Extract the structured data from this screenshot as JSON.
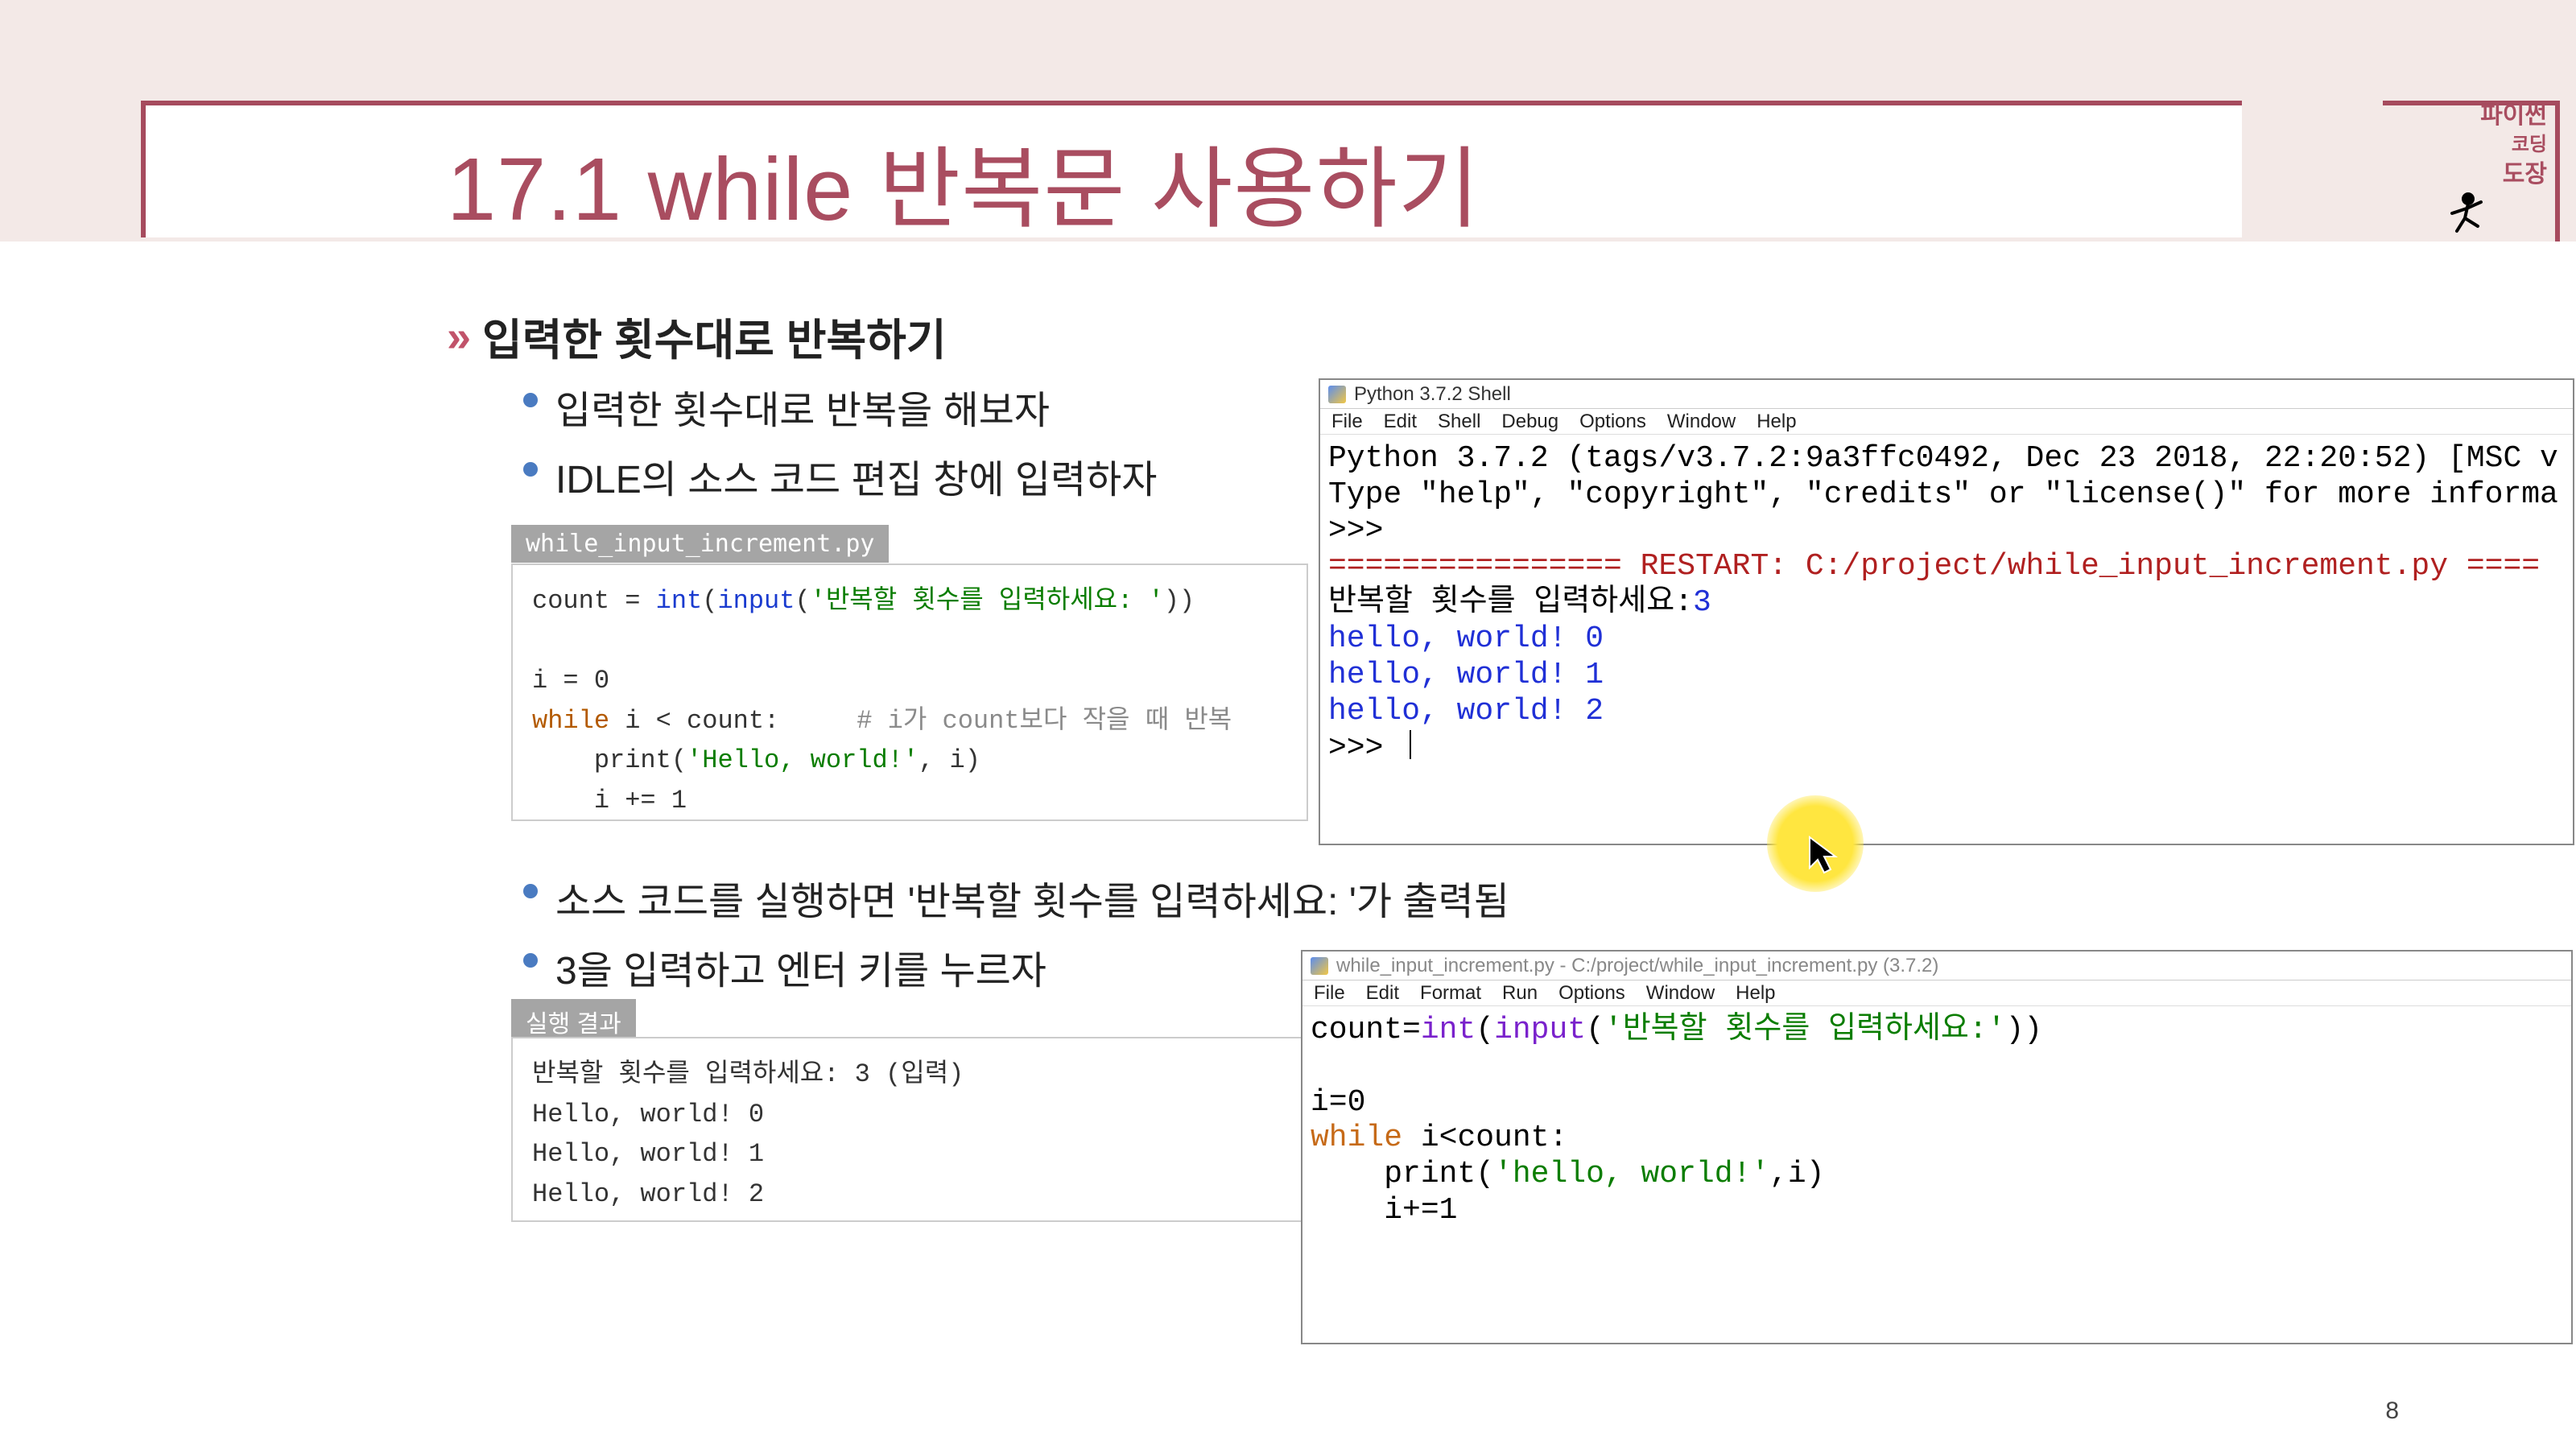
{
  "slide": {
    "title": "17.1 while 반복문 사용하기",
    "subheading": "입력한 횟수대로 반복하기",
    "bullets": [
      "입력한 횟수대로 반복을 해보자",
      "IDLE의 소스 코드 편집 창에 입력하자",
      "소스 코드를 실행하면 '반복할 횟수를 입력하세요: '가 출력됨",
      "3을 입력하고 엔터 키를 누르자"
    ],
    "logo_line1": "파이썬",
    "logo_line2": "코딩",
    "logo_line3": "도장",
    "page_number": "8"
  },
  "code_block": {
    "filename": "while_input_increment.py",
    "line1_a": "count = ",
    "line1_b": "int",
    "line1_c": "(",
    "line1_d": "input",
    "line1_e": "(",
    "line1_f": "'반복할 횟수를 입력하세요: '",
    "line1_g": "))",
    "line3": "i = 0",
    "line4_a": "while",
    "line4_b": " i < count:     ",
    "line4_c": "# i가 count보다 작을 때 반복",
    "line5_a": "    print(",
    "line5_b": "'Hello, world!'",
    "line5_c": ", i)",
    "line6": "    i += 1"
  },
  "result_block": {
    "label": "실행 결과",
    "line1": "반복할 횟수를 입력하세요: 3 (입력)",
    "line2": "Hello, world! 0",
    "line3": "Hello, world! 1",
    "line4": "Hello, world! 2"
  },
  "shell": {
    "title": "Python 3.7.2 Shell",
    "menus": [
      "File",
      "Edit",
      "Shell",
      "Debug",
      "Options",
      "Window",
      "Help"
    ],
    "banner1": "Python 3.7.2 (tags/v3.7.2:9a3ffc0492, Dec 23 2018, 22:20:52) [MSC v",
    "banner2": "Type \"help\", \"copyright\", \"credits\" or \"license()\" for more informa",
    "prompt": ">>>",
    "restart": "================ RESTART: C:/project/while_input_increment.py ====",
    "input_line_pre": "반복할 횟수를 입력하세요:",
    "input_user": "3",
    "out1": "hello, world! 0",
    "out2": "hello, world! 1",
    "out3": "hello, world! 2"
  },
  "editor": {
    "title": "while_input_increment.py - C:/project/while_input_increment.py (3.7.2)",
    "menus": [
      "File",
      "Edit",
      "Format",
      "Run",
      "Options",
      "Window",
      "Help"
    ],
    "l1_a": "count=",
    "l1_b": "int",
    "l1_c": "(",
    "l1_d": "input",
    "l1_e": "(",
    "l1_f": "'반복할 횟수를 입력하세요:'",
    "l1_g": "))",
    "l3": "i=0",
    "l4_a": "while",
    "l4_b": " i<count:",
    "l5_a": "    print(",
    "l5_b": "'hello, world!'",
    "l5_c": ",i)",
    "l6": "    i+=1"
  }
}
